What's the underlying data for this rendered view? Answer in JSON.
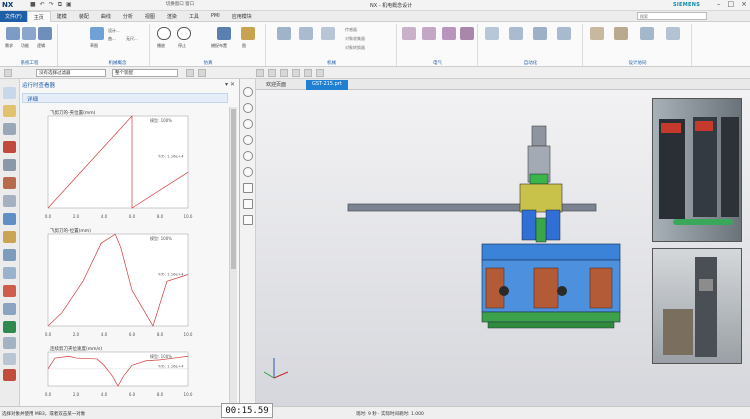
{
  "app": {
    "logo": "NX",
    "window_title": "NX - 机电概念设计",
    "brand": "SIEMENS",
    "qat_label": "切换窗口  窗口"
  },
  "tabs": {
    "file": "文件(F)",
    "items": [
      "主页",
      "建模",
      "装配",
      "曲线",
      "分析",
      "视图",
      "渲染",
      "工具",
      "PMI",
      "应用模块"
    ],
    "active_index": 0,
    "search_placeholder": "搜索"
  },
  "ribbon": {
    "groups": [
      {
        "label": "系统工程",
        "buttons": [
          "需求",
          "功能",
          "逻辑",
          "需求管理"
        ]
      },
      {
        "label": "机械概念",
        "buttons": [
          "草图",
          "设计...",
          "设计...",
          "曲...",
          "无尺...",
          "无..."
        ]
      },
      {
        "label": "仿真",
        "buttons": [
          "播放",
          "停止",
          "捕捉布置",
          "图"
        ]
      },
      {
        "label": "机械",
        "buttons": [
          "刚体",
          "碰撞体",
          "对象源",
          "传感器",
          "对象收集器",
          "对象转换器"
        ]
      },
      {
        "label": "电气",
        "buttons": [
          "速度控制",
          "位置控制",
          "信号适配器",
          "符号表"
        ]
      },
      {
        "label": "自动化",
        "buttons": [
          "仿真序列",
          "运行时参数",
          "运行时表达式",
          "运行时行为"
        ]
      },
      {
        "label": "设计协同",
        "buttons": [
          "导出",
          "导入",
          "导出至 Teamcenter",
          "序列编辑器"
        ]
      }
    ]
  },
  "selection_bar": {
    "filter": "没有选择过滤器",
    "scope": "整个装配"
  },
  "panel": {
    "title": "运行时查看器",
    "section": "详细",
    "charts": [
      {
        "title": "飞剪刀的-夹位置(mm)",
        "legend": "模型: 100%",
        "right_label": "Y(f): 1.16e+4"
      },
      {
        "title": "飞剪刀的-位置(mm)",
        "legend": "模型: 100%",
        "right_label": "Y(f): 1.16e+4"
      },
      {
        "title": "连续剪刀夹位速度(mm/s)",
        "legend": "模型: 100%",
        "right_label": "Y(f): 1.16e+4"
      }
    ]
  },
  "graphics": {
    "tabs": [
      "欢迎页面",
      "GST-215.prt"
    ],
    "active_tab": 1
  },
  "status": {
    "left": "选择对象并使用 MB3，或者双击某一对象",
    "right": "现时: 9 秒 · 实际时间耗时: 1.000"
  },
  "overlay": {
    "timer": "00:15.59"
  },
  "chart_data": [
    {
      "type": "line",
      "title": "飞剪刀的-夹位置(mm)",
      "x": [
        0.0,
        6.0,
        6.0,
        10.0
      ],
      "y": [
        0,
        360,
        0,
        140
      ],
      "xlim": [
        0,
        10
      ],
      "ylim": [
        0,
        360
      ],
      "x_ticks": [
        "0.0",
        "2.0",
        "4.0",
        "6.0",
        "8.0",
        "10.0"
      ],
      "series": [
        {
          "name": "模型: 100%"
        }
      ]
    },
    {
      "type": "line",
      "title": "飞剪刀的-位置(mm)",
      "x": [
        0.0,
        1.0,
        2.5,
        3.8,
        4.8,
        5.2,
        6.0,
        7.5,
        8.5,
        10.0
      ],
      "y": [
        0,
        60,
        200,
        370,
        410,
        350,
        160,
        0,
        200,
        230
      ],
      "xlim": [
        0,
        10
      ],
      "ylim": [
        0,
        411
      ],
      "x_ticks": [
        "0.0",
        "2.0",
        "4.0",
        "6.0",
        "8.0",
        "10.0"
      ],
      "series": [
        {
          "name": "模型: 100%"
        }
      ]
    },
    {
      "type": "line",
      "title": "连续剪刀夹位速度(mm/s)",
      "x": [
        0.0,
        0.5,
        1.5,
        2.0,
        3.5,
        4.0,
        4.6,
        5.0,
        5.4,
        6.0,
        7.0,
        8.0,
        9.0,
        10.0
      ],
      "y": [
        0,
        120,
        140,
        120,
        110,
        40,
        -80,
        -190,
        -80,
        40,
        90,
        100,
        120,
        140
      ],
      "xlim": [
        0,
        10
      ],
      "ylim": [
        -190,
        187
      ],
      "x_ticks": [
        "0.0",
        "2.0",
        "4.0",
        "6.0",
        "8.0",
        "10.0"
      ],
      "series": [
        {
          "name": "模型: 100%"
        }
      ]
    }
  ]
}
